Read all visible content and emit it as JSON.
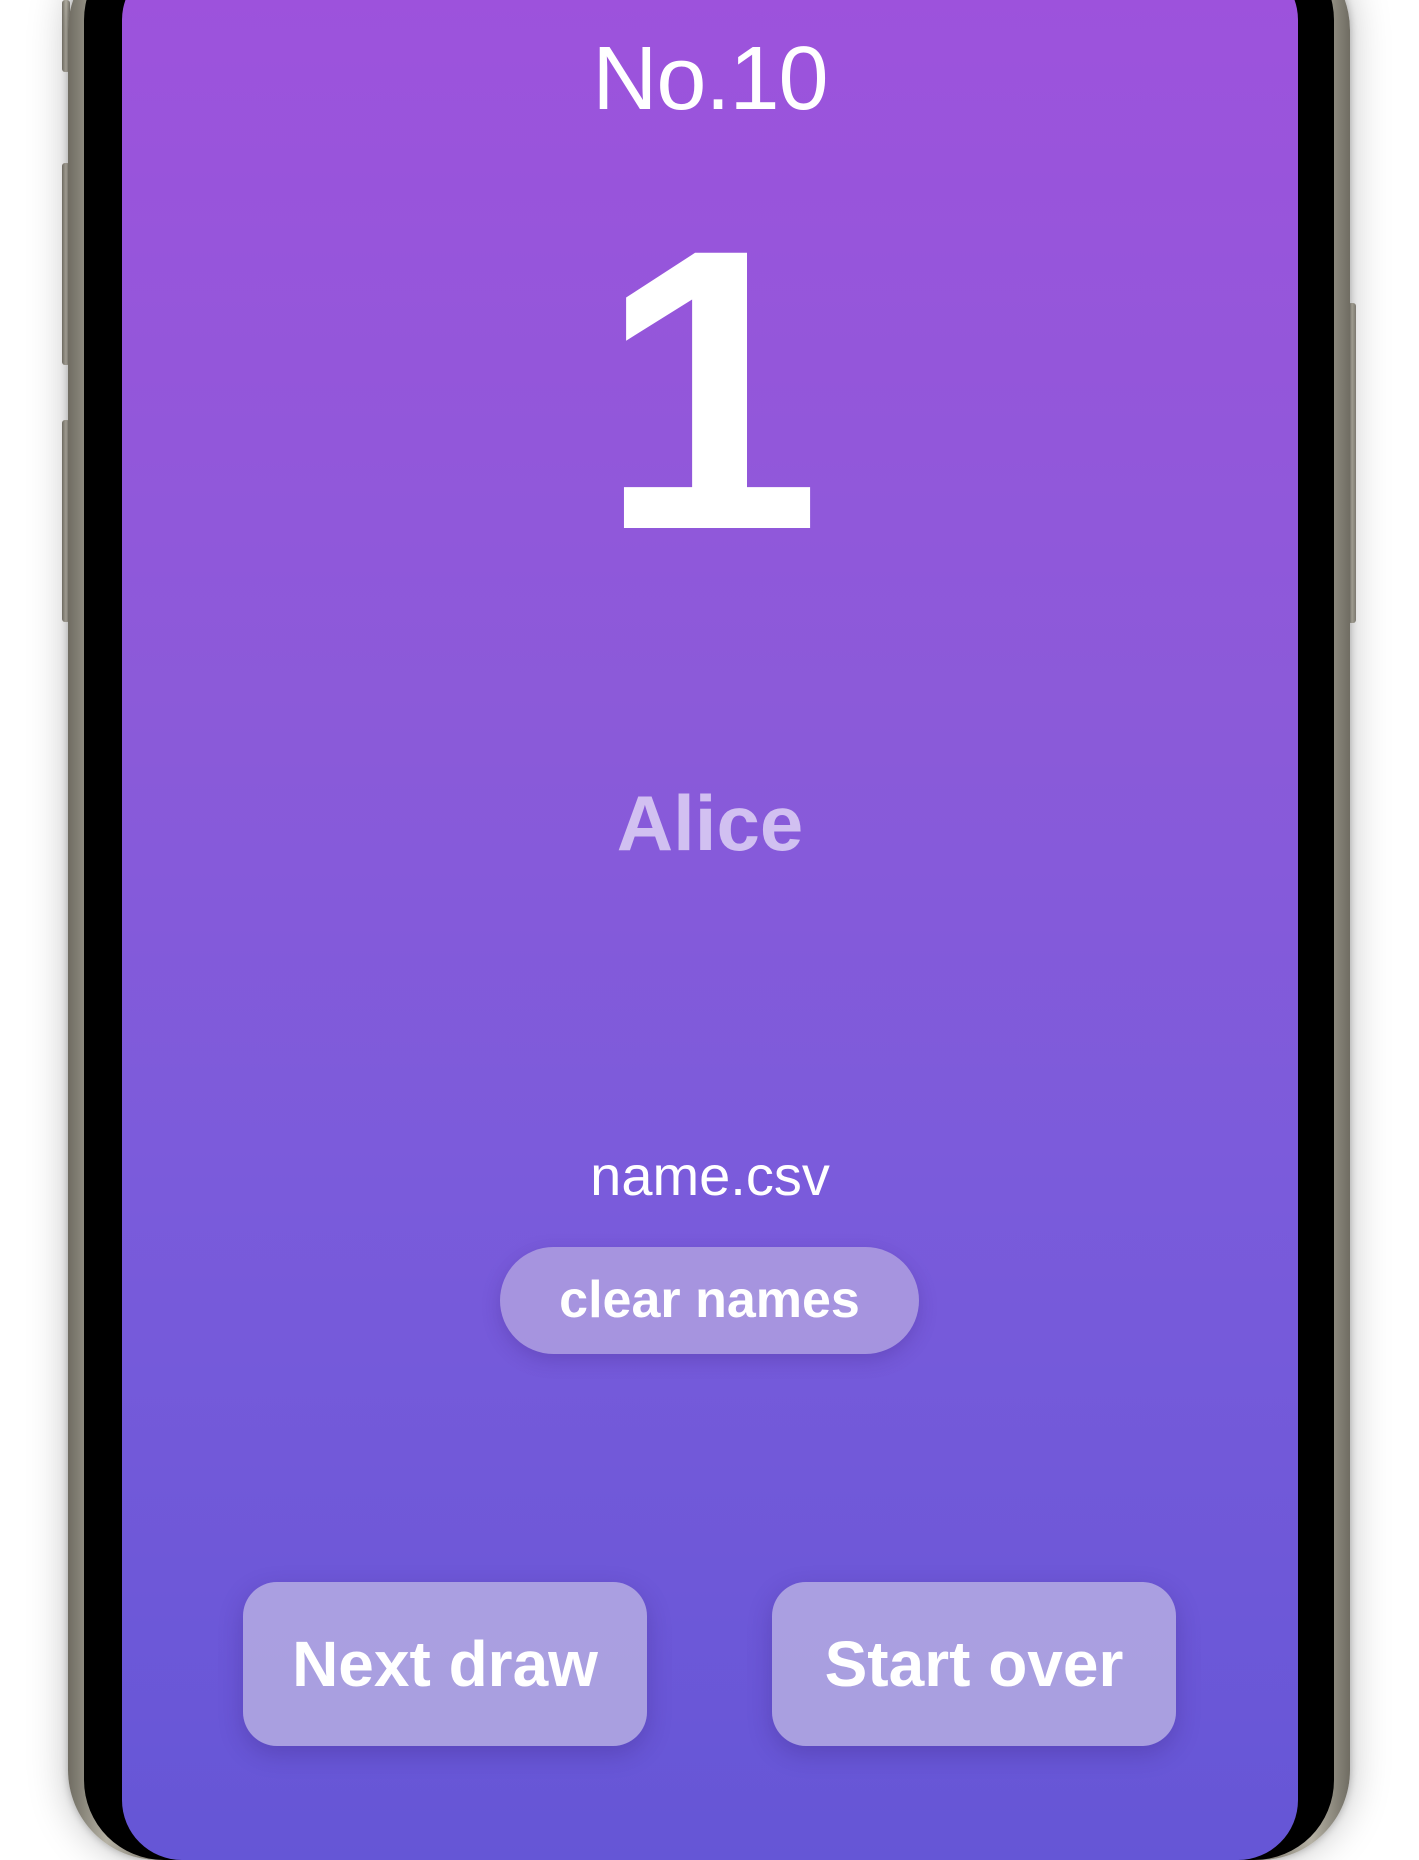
{
  "draw": {
    "title": "No.10",
    "number": "1",
    "name": "Alice"
  },
  "file": {
    "name": "name.csv",
    "clear_label": "clear names"
  },
  "actions": {
    "next_label": "Next draw",
    "restart_label": "Start over"
  },
  "colors": {
    "background_top": "#9e52dc",
    "background_bottom": "#6556d6",
    "text": "#ffffff"
  }
}
